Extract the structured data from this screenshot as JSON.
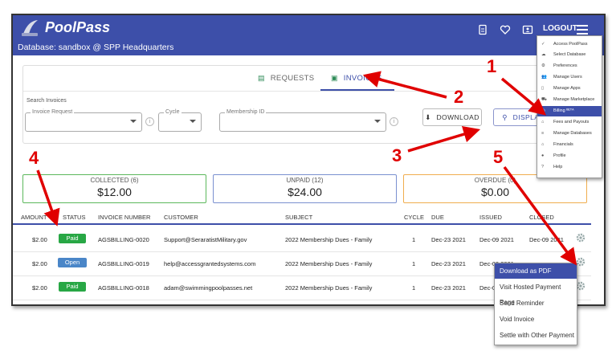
{
  "app": {
    "logo_text": "PoolPass",
    "database_line": "Database: sandbox @ SPP Headquarters",
    "logout_label": "LOGOUT"
  },
  "tabs": {
    "requests": "REQUESTS",
    "invoices": "INVOICES"
  },
  "search": {
    "label": "Search Invoices",
    "invoice_request_legend": "Invoice Request",
    "cycle_legend": "Cycle",
    "membership_id_legend": "Membership ID",
    "download_label": "DOWNLOAD",
    "display_label": "DISPLAY"
  },
  "summary": {
    "collected_label": "COLLECTED (6)",
    "collected_value": "$12.00",
    "unpaid_label": "UNPAID (12)",
    "unpaid_value": "$24.00",
    "overdue_label": "OVERDUE (0)",
    "overdue_value": "$0.00"
  },
  "table": {
    "headers": [
      "AMOUNT",
      "STATUS",
      "INVOICE NUMBER",
      "CUSTOMER",
      "SUBJECT",
      "CYCLE",
      "DUE",
      "ISSUED",
      "CLOSED"
    ],
    "rows": [
      {
        "amount": "$2.00",
        "status": "Paid",
        "invoice": "AGSBILLING-0020",
        "customer": "Support@SeraratistMilitary.gov",
        "subject": "2022 Membership Dues - Family",
        "cycle": "1",
        "due": "Dec-23 2021",
        "issued": "Dec-09 2021",
        "closed": "Dec-09 2021"
      },
      {
        "amount": "$2.00",
        "status": "Open",
        "invoice": "AGSBILLING-0019",
        "customer": "help@accessgrantedsystems.com",
        "subject": "2022 Membership Dues - Family",
        "cycle": "1",
        "due": "Dec-23 2021",
        "issued": "Dec-09 2021",
        "closed": ""
      },
      {
        "amount": "$2.00",
        "status": "Paid",
        "invoice": "AGSBILLING-0018",
        "customer": "adam@swimmingpoolpasses.net",
        "subject": "2022 Membership Dues - Family",
        "cycle": "1",
        "due": "Dec-23 2021",
        "issued": "Dec-09 2021",
        "closed": ""
      }
    ]
  },
  "menu": {
    "items": [
      {
        "label": "Access PoolPass",
        "icon": "check-icon"
      },
      {
        "label": "Select Database",
        "icon": "cloud-icon"
      },
      {
        "label": "Preferences",
        "icon": "gear-icon"
      },
      {
        "label": "Manage Users",
        "icon": "users-icon"
      },
      {
        "label": "Manage Apps",
        "icon": "phone-icon"
      },
      {
        "label": "Manage Marketplace",
        "icon": "cart-icon"
      },
      {
        "label": "Billing ᴮᴱᵀᴬ",
        "icon": "billing-icon",
        "active": true
      },
      {
        "label": "Fees and Payouts",
        "icon": "bank-icon"
      },
      {
        "label": "Manage Databases",
        "icon": "database-icon"
      },
      {
        "label": "Financials",
        "icon": "bank-icon"
      },
      {
        "label": "Profile",
        "icon": "profile-icon"
      },
      {
        "label": "Help",
        "icon": "help-icon"
      }
    ]
  },
  "context_menu": {
    "items": [
      {
        "label": "Download as PDF",
        "active": true
      },
      {
        "label": "Visit Hosted Payment Page"
      },
      {
        "label": "Send Reminder"
      },
      {
        "label": "Void Invoice"
      },
      {
        "label": "Settle with Other Payment"
      }
    ]
  },
  "annotations": [
    "1",
    "2",
    "3",
    "4",
    "5"
  ],
  "colors": {
    "brand": "#3d4fa9",
    "paid": "#28a745",
    "open": "#4a86c8",
    "annotation": "#e00000"
  }
}
